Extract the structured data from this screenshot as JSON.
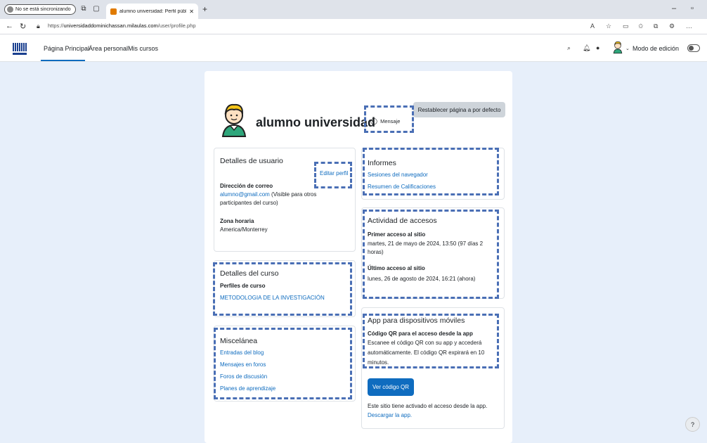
{
  "browser": {
    "sync_status": "No se está sincronizando",
    "tab_title": "alumno universidad: Perfil públic",
    "url_prefix": "https://",
    "url_domain": "universidaddominichassan.milaulas.com",
    "url_path": "/user/profile.php"
  },
  "navbar": {
    "links": [
      "Página Principal",
      "Área personal",
      "Mis cursos"
    ],
    "active_index": 0,
    "edit_mode_label": "Modo de edición",
    "edit_mode_on": false
  },
  "profile": {
    "reset_label": "Restablecer página a por defecto",
    "name": "alumno universidad",
    "message_label": "Mensaje"
  },
  "user_details": {
    "title": "Detalles de usuario",
    "edit_link": "Editar perfil",
    "email_label": "Dirección de correo",
    "email": "alumno@gmail.com",
    "email_note_1": " (Visible para otros",
    "email_note_2": "participantes del curso)",
    "timezone_label": "Zona horaria",
    "timezone": "America/Monterrey"
  },
  "course_details": {
    "title": "Detalles del curso",
    "profiles_label": "Perfiles de curso",
    "course": "METODOLOGIA DE LA INVESTIGACIÓN"
  },
  "misc": {
    "title": "Miscelánea",
    "links": [
      "Entradas del blog",
      "Mensajes en foros",
      "Foros de discusión",
      "Planes de aprendizaje"
    ]
  },
  "reports": {
    "title": "Informes",
    "links": [
      "Sesiones del navegador",
      "Resumen de Calificaciones"
    ]
  },
  "access": {
    "title": "Actividad de accesos",
    "first_label": "Primer acceso al sitio",
    "first_value_1": "martes, 21 de mayo de 2024, 13:50  (97 días 2",
    "first_value_2": "horas)",
    "last_label": "Último acceso al sitio",
    "last_value": "lunes, 26 de agosto de 2024, 16:21  (ahora)"
  },
  "mobile": {
    "title": "App para dispositivos móviles",
    "qr_label": "Código QR para el acceso desde la app",
    "qr_text_1": "Escanee el código QR con su app y accederá",
    "qr_text_2": "automáticamente. El código QR expirará en 10",
    "qr_text_3": "minutos.",
    "qr_button": "Ver código QR",
    "app_note": "Este sitio tiene activado el acceso desde la app.",
    "download_link": "Descargar la app."
  },
  "help_label": "?",
  "colors": {
    "link": "#0f6cbf",
    "page_bg": "#e7effa",
    "highlight_dash": "#4a6fb5"
  }
}
